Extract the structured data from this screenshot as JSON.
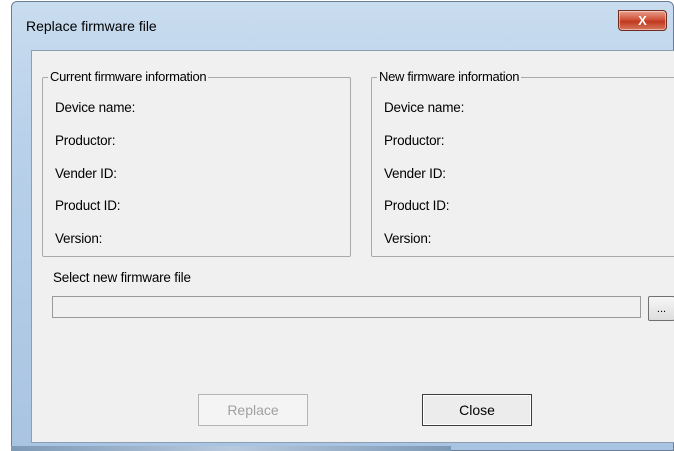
{
  "window": {
    "title": "Replace firmware file",
    "close_glyph": "X"
  },
  "current_group": {
    "title": "Current firmware information",
    "fields": [
      "Device name:",
      "Productor:",
      "Vender ID:",
      "Product ID:",
      "Version:"
    ]
  },
  "new_group": {
    "title": "New firmware information",
    "fields": [
      "Device name:",
      "Productor:",
      "Vender ID:",
      "Product ID:",
      "Version:"
    ]
  },
  "select": {
    "label": "Select new firmware file",
    "path_value": "",
    "browse_label": "..."
  },
  "buttons": {
    "replace_label": "Replace",
    "close_label": "Close"
  }
}
